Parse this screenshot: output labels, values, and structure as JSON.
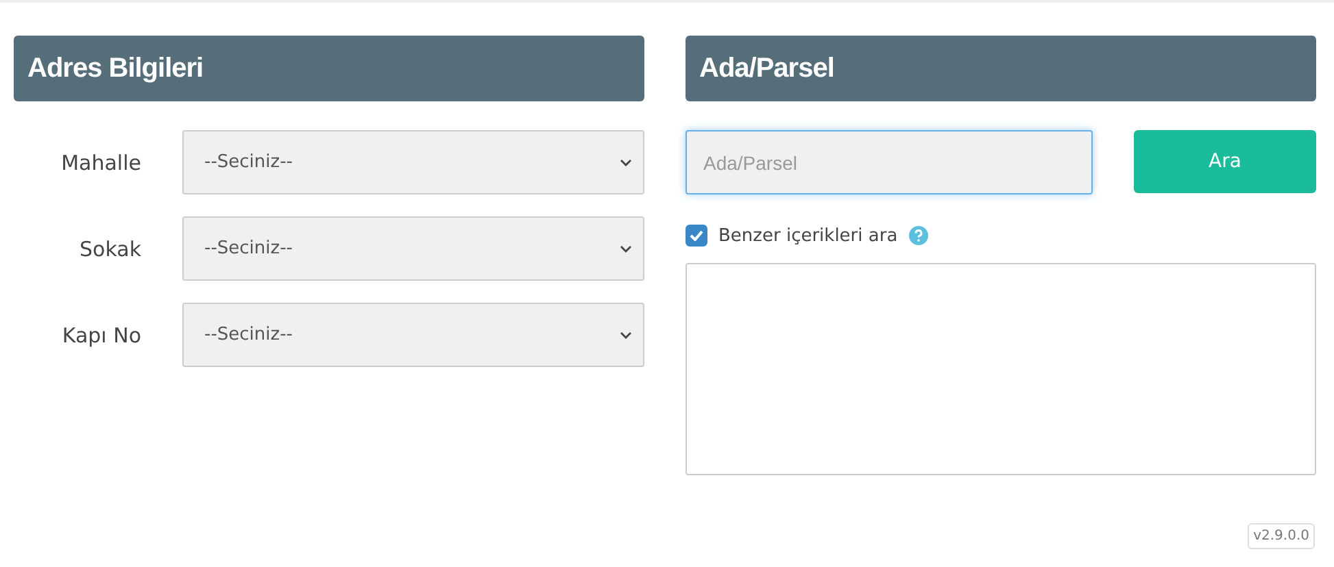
{
  "address_panel": {
    "title": "Adres Bilgileri",
    "fields": [
      {
        "label": "Mahalle",
        "value": "--Seciniz--"
      },
      {
        "label": "Sokak",
        "value": "--Seciniz--"
      },
      {
        "label": "Kapı No",
        "value": "--Seciniz--"
      }
    ]
  },
  "parcel_panel": {
    "title": "Ada/Parsel",
    "search": {
      "placeholder": "Ada/Parsel",
      "focused": true
    },
    "search_button": "Ara",
    "similar": {
      "label": "Benzer içerikleri ara",
      "checked": true
    }
  },
  "version": "v2.9.0.0"
}
